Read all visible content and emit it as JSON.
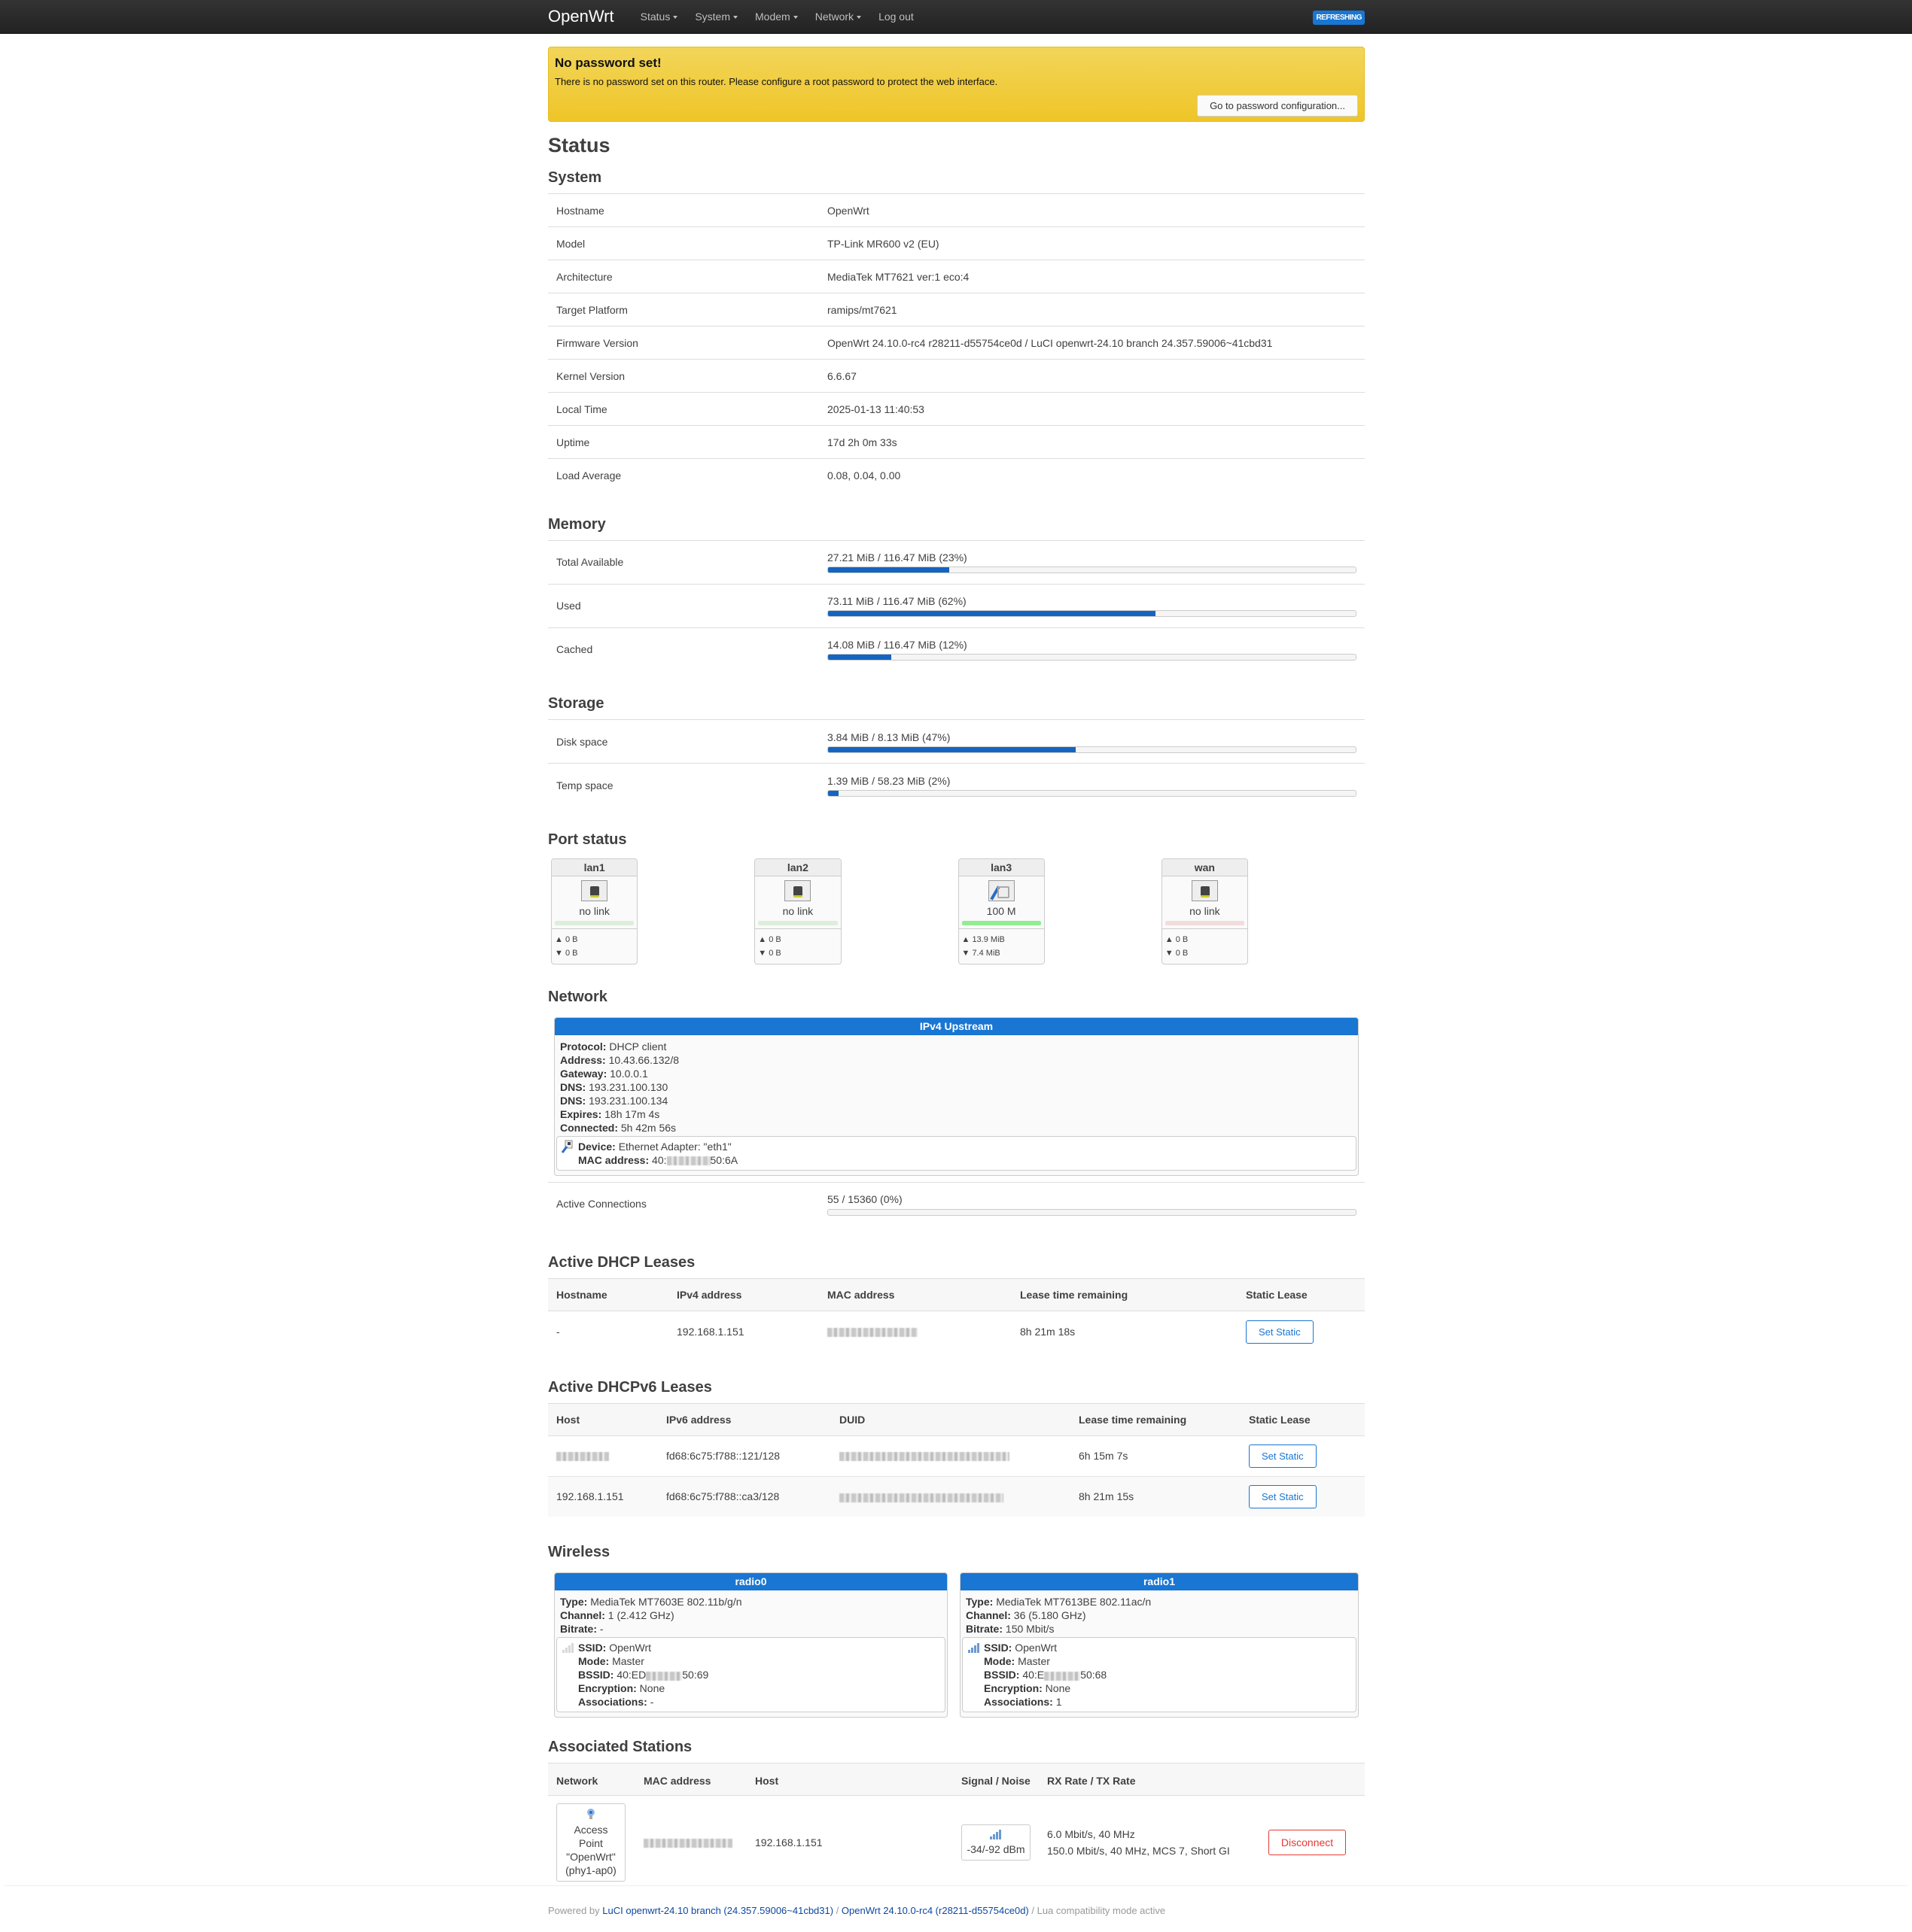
{
  "nav": {
    "brand": "OpenWrt",
    "menu": [
      {
        "label": "Status",
        "dropdown": true
      },
      {
        "label": "System",
        "dropdown": true
      },
      {
        "label": "Modem",
        "dropdown": true
      },
      {
        "label": "Network",
        "dropdown": true
      },
      {
        "label": "Log out",
        "dropdown": false
      }
    ],
    "badge": "REFRESHING",
    "accent": "#1976d2"
  },
  "alert": {
    "title": "No password set!",
    "message": "There is no password set on this router. Please configure a root password to protect the web interface.",
    "button": "Go to password configuration..."
  },
  "page_title": "Status",
  "system": {
    "heading": "System",
    "rows": [
      {
        "key": "Hostname",
        "value": "OpenWrt"
      },
      {
        "key": "Model",
        "value": "TP-Link MR600 v2 (EU)"
      },
      {
        "key": "Architecture",
        "value": "MediaTek MT7621 ver:1 eco:4"
      },
      {
        "key": "Target Platform",
        "value": "ramips/mt7621"
      },
      {
        "key": "Firmware Version",
        "value": "OpenWrt 24.10.0-rc4 r28211-d55754ce0d / LuCI openwrt-24.10 branch 24.357.59006~41cbd31"
      },
      {
        "key": "Kernel Version",
        "value": "6.6.67"
      },
      {
        "key": "Local Time",
        "value": "2025-01-13 11:40:53"
      },
      {
        "key": "Uptime",
        "value": "17d 2h 0m 33s"
      },
      {
        "key": "Load Average",
        "value": "0.08, 0.04, 0.00"
      }
    ]
  },
  "memory": {
    "heading": "Memory",
    "rows": [
      {
        "key": "Total Available",
        "value": "27.21 MiB / 116.47 MiB (23%)",
        "percent": 23
      },
      {
        "key": "Used",
        "value": "73.11 MiB / 116.47 MiB (62%)",
        "percent": 62
      },
      {
        "key": "Cached",
        "value": "14.08 MiB / 116.47 MiB (12%)",
        "percent": 12
      }
    ]
  },
  "storage": {
    "heading": "Storage",
    "rows": [
      {
        "key": "Disk space",
        "value": "3.84 MiB / 8.13 MiB (47%)",
        "percent": 47
      },
      {
        "key": "Temp space",
        "value": "1.39 MiB / 58.23 MiB (2%)",
        "percent": 2
      }
    ]
  },
  "ports": {
    "heading": "Port status",
    "items": [
      {
        "name": "lan1",
        "speed": "no link",
        "link": false,
        "tx": "▲ 0 B",
        "rx": "▼ 0 B",
        "bar_color": "#dcefdc"
      },
      {
        "name": "lan2",
        "speed": "no link",
        "link": false,
        "tx": "▲ 0 B",
        "rx": "▼ 0 B",
        "bar_color": "#dcefdc"
      },
      {
        "name": "lan3",
        "speed": "100 M",
        "link": true,
        "tx": "▲ 13.9 MiB",
        "rx": "▼ 7.4 MiB",
        "bar_color": "#90ee90"
      },
      {
        "name": "wan",
        "speed": "no link",
        "link": false,
        "tx": "▲ 0 B",
        "rx": "▼ 0 B",
        "bar_color": "#f2dcdc"
      }
    ]
  },
  "network": {
    "heading": "Network",
    "upstream": {
      "title": "IPv4 Upstream",
      "fields": [
        {
          "k": "Protocol:",
          "v": "DHCP client"
        },
        {
          "k": "Address:",
          "v": "10.43.66.132/8"
        },
        {
          "k": "Gateway:",
          "v": "10.0.0.1"
        },
        {
          "k": "DNS:",
          "v": "193.231.100.130"
        },
        {
          "k": "DNS:",
          "v": "193.231.100.134"
        },
        {
          "k": "Expires:",
          "v": "18h 17m 4s"
        },
        {
          "k": "Connected:",
          "v": "5h 42m 56s"
        }
      ],
      "device_label": "Device:",
      "device_value": "Ethernet Adapter: \"eth1\"",
      "mac_label": "MAC address:",
      "mac_prefix": "40:",
      "mac_suffix": "50:6A"
    },
    "active_connections": {
      "key": "Active Connections",
      "value": "55 / 15360 (0%)",
      "percent": 0
    }
  },
  "dhcp": {
    "heading": "Active DHCP Leases",
    "columns": [
      "Hostname",
      "IPv4 address",
      "MAC address",
      "Lease time remaining",
      "Static Lease"
    ],
    "rows": [
      {
        "hostname": "-",
        "ipv4": "192.168.1.151",
        "mac": "[redacted]",
        "lease": "8h 21m 18s",
        "button": "Set Static"
      }
    ]
  },
  "dhcpv6": {
    "heading": "Active DHCPv6 Leases",
    "columns": [
      "Host",
      "IPv6 address",
      "DUID",
      "Lease time remaining",
      "Static Lease"
    ],
    "rows": [
      {
        "host": "[redacted]",
        "ipv6": "fd68:6c75:f788::121/128",
        "duid": "[redacted]",
        "lease": "6h 15m 7s",
        "button": "Set Static"
      },
      {
        "host": "192.168.1.151",
        "ipv6": "fd68:6c75:f788::ca3/128",
        "duid": "[redacted]",
        "lease": "8h 21m 15s",
        "button": "Set Static"
      }
    ]
  },
  "wireless": {
    "heading": "Wireless",
    "radios": [
      {
        "title": "radio0",
        "type_k": "Type:",
        "type": "MediaTek MT7603E 802.11b/g/n",
        "channel_k": "Channel:",
        "channel": "1 (2.412 GHz)",
        "bitrate_k": "Bitrate:",
        "bitrate": "-",
        "ssid_k": "SSID:",
        "ssid": "OpenWrt",
        "mode_k": "Mode:",
        "mode": "Master",
        "bssid_k": "BSSID:",
        "bssid_prefix": "40:ED",
        "bssid_suffix": "50:69",
        "enc_k": "Encryption:",
        "encryption": "None",
        "assoc_k": "Associations:",
        "associations": "-",
        "signal_active": false
      },
      {
        "title": "radio1",
        "type_k": "Type:",
        "type": "MediaTek MT7613BE 802.11ac/n",
        "channel_k": "Channel:",
        "channel": "36 (5.180 GHz)",
        "bitrate_k": "Bitrate:",
        "bitrate": "150 Mbit/s",
        "ssid_k": "SSID:",
        "ssid": "OpenWrt",
        "mode_k": "Mode:",
        "mode": "Master",
        "bssid_k": "BSSID:",
        "bssid_prefix": "40:E",
        "bssid_suffix": "50:68",
        "enc_k": "Encryption:",
        "encryption": "None",
        "assoc_k": "Associations:",
        "associations": "1",
        "signal_active": true
      }
    ]
  },
  "stations": {
    "heading": "Associated Stations",
    "columns": [
      "Network",
      "MAC address",
      "Host",
      "Signal / Noise",
      "RX Rate / TX Rate"
    ],
    "rows": [
      {
        "network_lines": [
          "Access",
          "Point",
          "\"OpenWrt\"",
          "(phy1-ap0)"
        ],
        "mac": "[redacted]",
        "host": "192.168.1.151",
        "signal": "-34/-92 dBm",
        "rx": "6.0 Mbit/s, 40 MHz",
        "tx": "150.0 Mbit/s, 40 MHz, MCS 7, Short GI",
        "button": "Disconnect"
      }
    ]
  },
  "footer": {
    "prefix": "Powered by ",
    "luci_link": "LuCI openwrt-24.10 branch (24.357.59006~41cbd31)",
    "sep": " / ",
    "openwrt_link": "OpenWrt 24.10.0-rc4 (r28211-d55754ce0d)",
    "suffix": " / Lua compatibility mode active"
  }
}
